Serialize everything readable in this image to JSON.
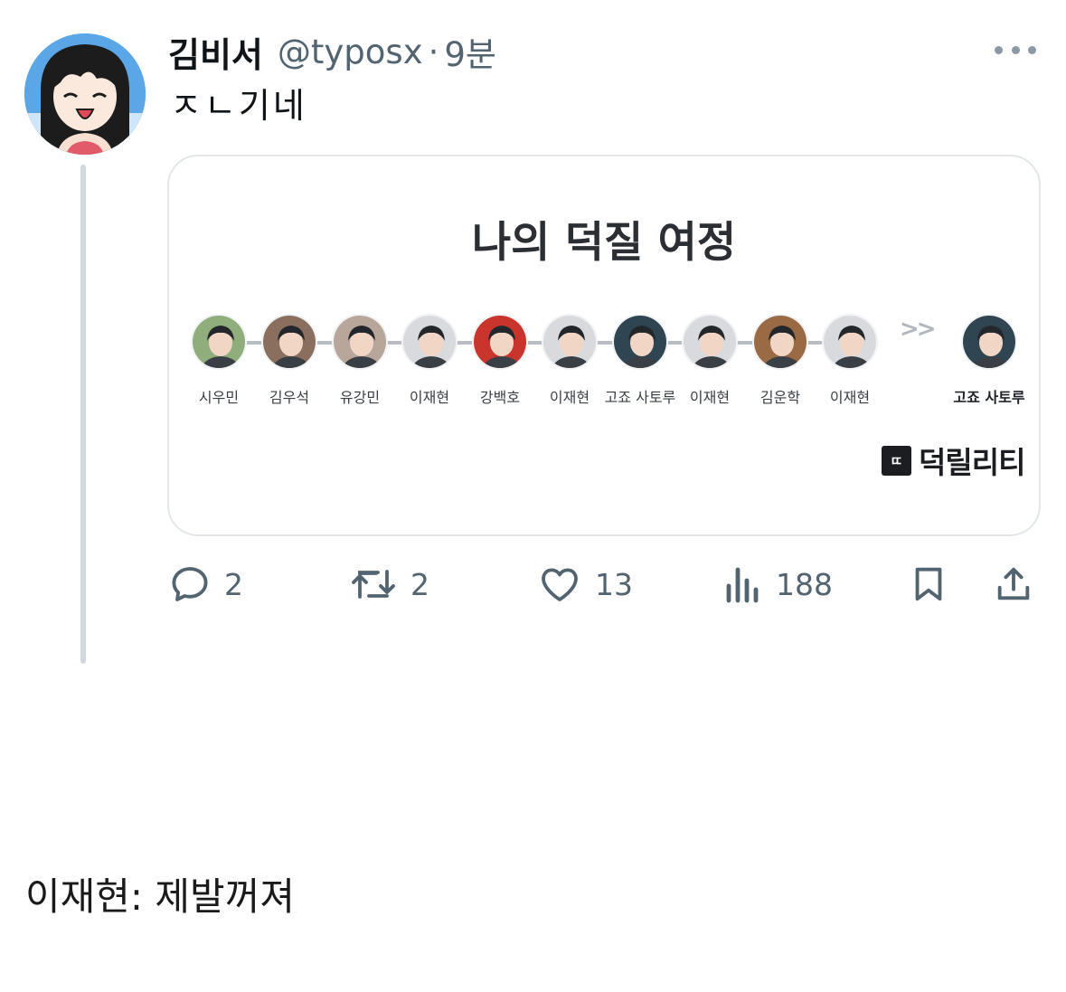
{
  "tweet": {
    "author_name": "김비서",
    "handle": "@typosx",
    "separator": "·",
    "time": "9분",
    "text": "ㅈㄴ기네",
    "avatar_icon": "anime-girl-avatar",
    "more_icon": "more-dots-icon"
  },
  "card": {
    "title": "나의 덕질 여정",
    "journey": [
      {
        "name": "시우민",
        "color": "#8fae7c"
      },
      {
        "name": "김우석",
        "color": "#8a6f5e"
      },
      {
        "name": "유강민",
        "color": "#b8a69a"
      },
      {
        "name": "이재현",
        "color": "#d9dadd"
      },
      {
        "name": "강백호",
        "color": "#c9342c"
      },
      {
        "name": "이재현",
        "color": "#d9dadd"
      },
      {
        "name": "고죠 사토루",
        "color": "#2f4552"
      },
      {
        "name": "이재현",
        "color": "#d9dadd"
      },
      {
        "name": "김운학",
        "color": "#9a6a44"
      },
      {
        "name": "이재현",
        "color": "#d9dadd"
      }
    ],
    "arrow": ">>",
    "final": {
      "name": "고죠 사토루",
      "color": "#2f4552"
    },
    "brand_mark": "ㄸ",
    "brand_name": "덕릴리티"
  },
  "actions": {
    "reply_count": "2",
    "retweet_count": "2",
    "like_count": "13",
    "views_count": "188"
  },
  "caption": "이재현: 제발꺼져",
  "colors": {
    "text_primary": "#0f1419",
    "text_secondary": "#536471",
    "border": "#e3e7ea",
    "thread_line": "#cfd9de"
  }
}
